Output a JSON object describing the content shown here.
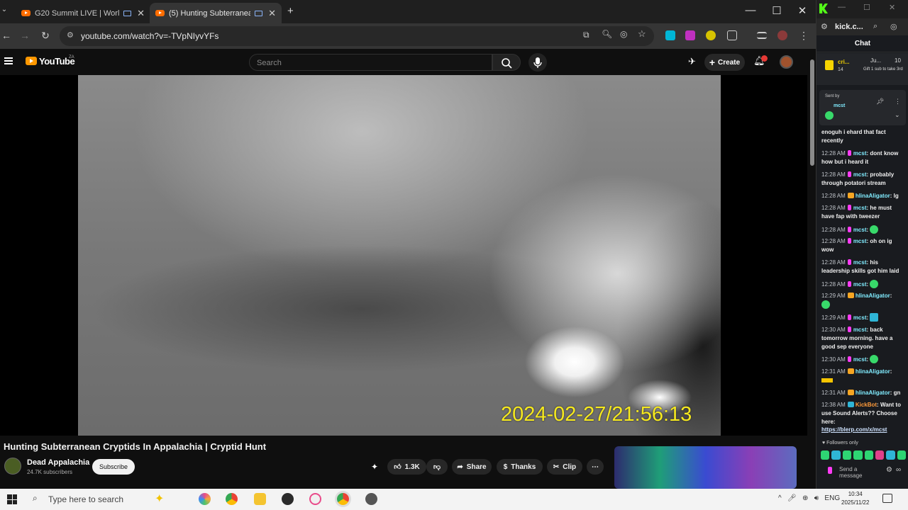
{
  "browser": {
    "tabs": [
      {
        "label": "G20 Summit LIVE | World Le"
      },
      {
        "label": "(5) Hunting Subterranean C"
      }
    ],
    "new_tab": "+",
    "address": "youtube.com/watch?v=-TVpNIyvYFs",
    "window_controls": {
      "minimize": "—",
      "maximize": "☐",
      "close": "✕"
    }
  },
  "youtube": {
    "logo_text": "YouTube",
    "region": "ZA",
    "search_placeholder": "Search",
    "create_label": "Create",
    "notification_count": "9"
  },
  "video": {
    "overlay_timestamp": "2024-02-27/21:56:13",
    "title": "Hunting Subterranean Cryptids In Appalachia | Cryptid Hunt",
    "channel": "Dead Appalachia",
    "subscribers": "24.7K subscribers",
    "subscribe_label": "Subscribe",
    "likes": "1.3K",
    "share_label": "Share",
    "thanks_label": "Thanks",
    "clip_label": "Clip"
  },
  "kick_chat": {
    "site": "kick.c...",
    "header": "Chat",
    "pinned": {
      "user": "cri...",
      "count": "14",
      "gift_text": "Gift 1 sub to take 3rd",
      "other": "Ju...",
      "other_count": "10"
    },
    "sent_by": "Sent by",
    "sent_by_user": "mcst",
    "messages": [
      {
        "time": "",
        "user": "",
        "text": "enoguh i ehard that fact recently"
      },
      {
        "time": "12:28 AM",
        "user": "mcst",
        "text": "dont know how but i heard it"
      },
      {
        "time": "12:28 AM",
        "user": "mcst",
        "text": "probably through potatori stream"
      },
      {
        "time": "12:28 AM",
        "user": "hlinaAligator",
        "text": "lg"
      },
      {
        "time": "12:28 AM",
        "user": "mcst",
        "text": "he must have fap with tweezer"
      },
      {
        "time": "12:28 AM",
        "user": "mcst",
        "text": ""
      },
      {
        "time": "12:28 AM",
        "user": "mcst",
        "text": "oh on ig wow"
      },
      {
        "time": "12:28 AM",
        "user": "mcst",
        "text": "his leadership skills got him laid"
      },
      {
        "time": "12:28 AM",
        "user": "mcst",
        "text": ""
      },
      {
        "time": "12:29 AM",
        "user": "hlinaAligator",
        "text": ""
      },
      {
        "time": "12:29 AM",
        "user": "mcst",
        "text": ""
      },
      {
        "time": "12:30 AM",
        "user": "mcst",
        "text": "back tomorrow morning. have a good sep everyone"
      },
      {
        "time": "12:30 AM",
        "user": "mcst",
        "text": ""
      },
      {
        "time": "12:31 AM",
        "user": "hlinaAligator",
        "text": ""
      },
      {
        "time": "12:31 AM",
        "user": "hlinaAligator",
        "text": "gn"
      },
      {
        "time": "12:38 AM",
        "user": "KickBot",
        "text": "Want to use Sound Alerts?? Choose here:"
      },
      {
        "time": "",
        "user": "",
        "text": "https://blerp.com/x/mcst"
      }
    ],
    "followers_only": "Followers only",
    "send_placeholder": "Send a message"
  },
  "taskbar": {
    "search_placeholder": "Type here to search",
    "lang": "ENG",
    "time": "10:34",
    "date": "2025/11/22"
  }
}
